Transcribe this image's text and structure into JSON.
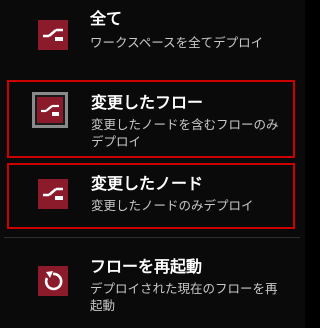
{
  "menu": {
    "items": [
      {
        "title": "全て",
        "description": "ワークスペースを全てデプロイ",
        "icon": "deploy-full-icon"
      },
      {
        "title": "変更したフロー",
        "description": "変更したノードを含むフローのみデプロイ",
        "icon": "deploy-flows-icon"
      },
      {
        "title": "変更したノード",
        "description": "変更したノードのみデプロイ",
        "icon": "deploy-nodes-icon"
      },
      {
        "title": "フローを再起動",
        "description": "デプロイされた現在のフローを再起動",
        "icon": "restart-icon"
      }
    ]
  },
  "colors": {
    "background": "#0a0a0a",
    "icon_bg": "#8b1a2b",
    "highlight_border": "#cc0000",
    "title_text": "#ffffff",
    "desc_text": "#c8c8c8"
  }
}
